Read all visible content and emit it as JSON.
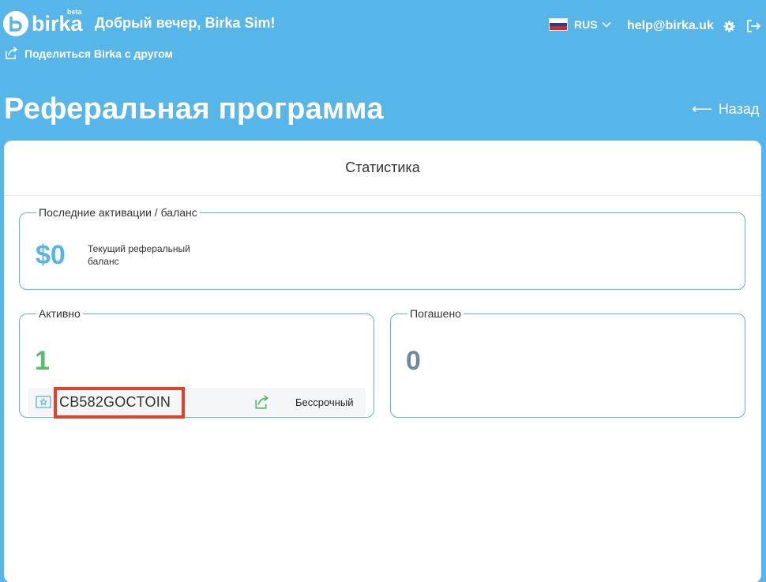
{
  "header": {
    "logo_text": "birka",
    "logo_beta": "beta",
    "greeting": "Добрый вечер, Birka Sim!",
    "share_friend": "Поделиться Birka с другом",
    "language": "RUS",
    "email": "help@birka.uk"
  },
  "page": {
    "title": "Реферальная программа",
    "back": "Назад"
  },
  "stats": {
    "heading": "Статистика",
    "balance_box": {
      "legend": "Последние активации / баланс",
      "amount": "$0",
      "label": "Текущий реферальный баланс"
    },
    "active_box": {
      "legend": "Активно",
      "count": "1",
      "code": "CB582GOCTOIN",
      "status": "Бессрочный"
    },
    "redeemed_box": {
      "legend": "Погашено",
      "count": "0"
    }
  },
  "colors": {
    "background": "#56b6ea",
    "active": "#5bbd6e",
    "redeemed": "#6e8a96",
    "highlight": "#e4412b"
  }
}
